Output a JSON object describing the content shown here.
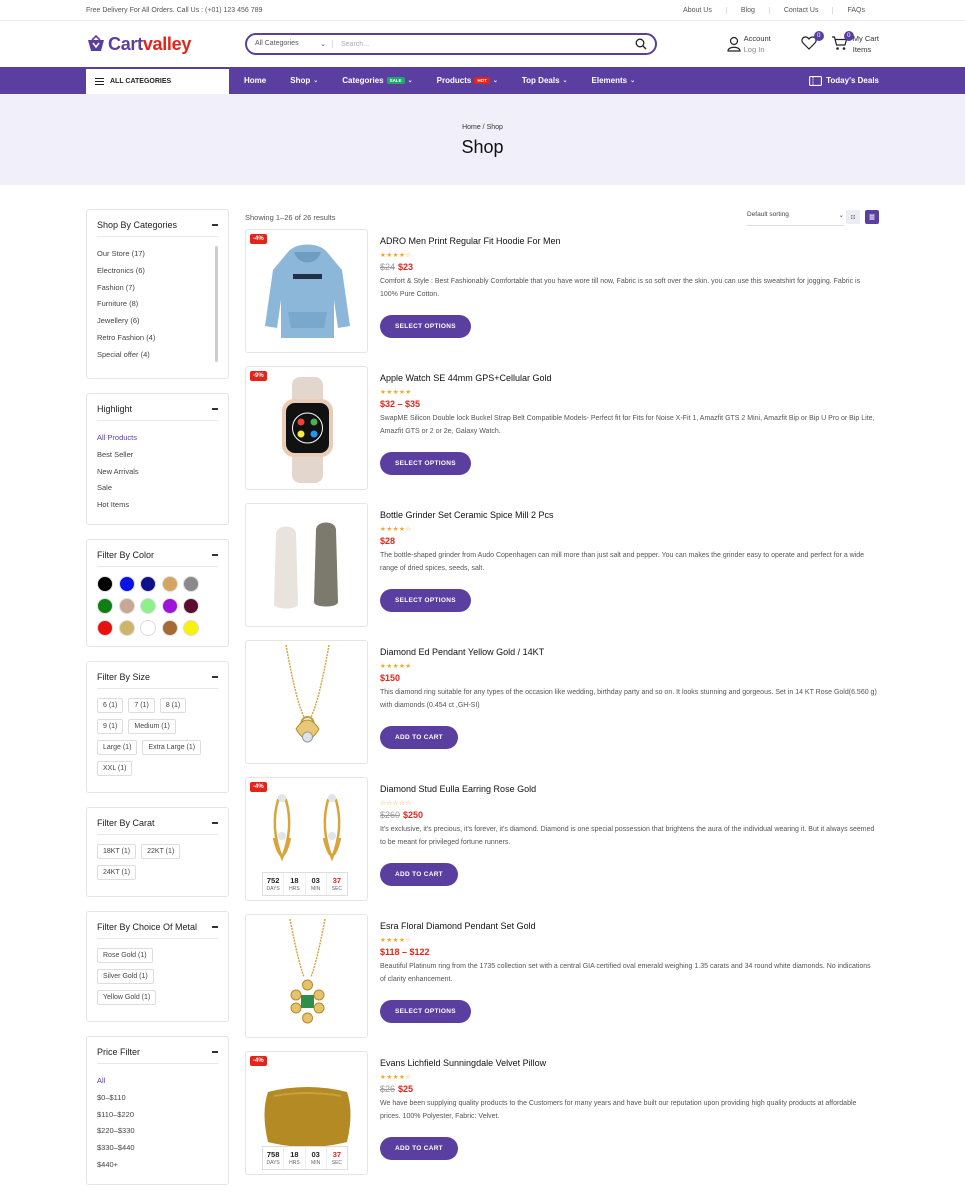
{
  "topbar": {
    "left": "Free Delivery For All Orders. Call Us : (+01) 123 456 789",
    "links": [
      "About Us",
      "Blog",
      "Contact Us",
      "FAQs"
    ]
  },
  "header": {
    "logo_part1": "Cart",
    "logo_part2": "valley",
    "search_category": "All Categories",
    "search_placeholder": "Search...",
    "account_label": "Account",
    "account_sub": "Log In",
    "wishlist_count": "0",
    "cart_count": "0",
    "cart_label": "My Cart",
    "cart_sub": "Items"
  },
  "nav": {
    "all_categories": "ALL CATEGORIES",
    "items": [
      {
        "label": "Home",
        "chev": "",
        "tag": ""
      },
      {
        "label": "Shop",
        "chev": "⌄",
        "tag": ""
      },
      {
        "label": "Categories",
        "chev": "⌄",
        "tag": "SALE"
      },
      {
        "label": "Products",
        "chev": "⌄",
        "tag": "HOT"
      },
      {
        "label": "Top Deals",
        "chev": "⌄",
        "tag": ""
      },
      {
        "label": "Elements",
        "chev": "⌄",
        "tag": ""
      }
    ],
    "deals": "Today's Deals",
    "sale_color": "#1fa86c",
    "hot_color": "#e2241b"
  },
  "banner": {
    "breadcrumb": "Home / Shop",
    "title": "Shop"
  },
  "sidebar": {
    "categories": {
      "title": "Shop By Categories",
      "items": [
        "Our Store (17)",
        "Electronics (6)",
        "Fashion (7)",
        "Furniture (8)",
        "Jewellery (6)",
        "Retro Fashion (4)",
        "Special offer (4)"
      ]
    },
    "highlight": {
      "title": "Highlight",
      "items": [
        "All Products",
        "Best Seller",
        "New Arrivals",
        "Sale",
        "Hot Items"
      ]
    },
    "color": {
      "title": "Filter By Color",
      "swatches": [
        "#000000",
        "#0a13e6",
        "#10108a",
        "#d6a461",
        "#8a8a8a",
        "#0f7f14",
        "#c8a893",
        "#8ef08a",
        "#9b16d9",
        "#5b0d2e",
        "#e8110f",
        "#cfb46b",
        "#ffffff",
        "#a66a35",
        "#f6f20a"
      ]
    },
    "size": {
      "title": "Filter By Size",
      "items": [
        "6 (1)",
        "7 (1)",
        "8 (1)",
        "9 (1)",
        "Medium (1)",
        "Large (1)",
        "Extra Large (1)",
        "XXL (1)"
      ]
    },
    "carat": {
      "title": "Filter By Carat",
      "items": [
        "18KT (1)",
        "22KT (1)",
        "24KT (1)"
      ]
    },
    "metal": {
      "title": "Filter By Choice Of Metal",
      "items": [
        "Rose Gold (1)",
        "Silver Gold (1)",
        "Yellow Gold (1)"
      ]
    },
    "price": {
      "title": "Price Filter",
      "items": [
        "All",
        "$0–$110",
        "$110–$220",
        "$220–$330",
        "$330–$440",
        "$440+"
      ]
    }
  },
  "toolbar": {
    "showing": "Showing 1–26 of 26 results",
    "sorting": "Default sorting"
  },
  "timer_labels": {
    "days": "DAYS",
    "hrs": "HRS",
    "min": "MIN",
    "sec": "SEC"
  },
  "products": [
    {
      "name": "ADRO Men Print Regular Fit Hoodie For Men",
      "discount": "-4%",
      "stars": "★★★★☆",
      "old_price": "$24",
      "price": "$23",
      "desc": "Comfort & Style : Best Fashionably Comfortable that you have wore till now, Fabric is so soft over the skin. you can use this sweatshirt for jogging. Fabric is 100% Pure Cotton.",
      "button": "SELECT OPTIONS",
      "image": "hoodie"
    },
    {
      "name": "Apple Watch SE 44mm GPS+Cellular Gold",
      "discount": "-9%",
      "stars": "★★★★★",
      "old_price": "",
      "price": "$32 – $35",
      "desc": "SwapME Silicon Double lock Buckel Strap Belt Compatible Models- Perfect fit for Fits for Noise X-Fit 1, Amazfit GTS 2 Mini, Amazfit Bip or Bip U Pro or Bip Lite, Amazfit GTS or 2 or 2e, Galaxy Watch.",
      "button": "SELECT OPTIONS",
      "image": "watch"
    },
    {
      "name": "Bottle Grinder Set Ceramic Spice Mill 2 Pcs",
      "discount": "",
      "stars": "★★★★☆",
      "old_price": "",
      "price": "$28",
      "desc": "The bottle-shaped grinder from Audo Copenhagen can mill more than just salt and pepper. You can makes the grinder easy to operate and perfect for a wide range of dried spices, seeds, salt.",
      "button": "SELECT OPTIONS",
      "image": "grinder"
    },
    {
      "name": "Diamond Ed Pendant Yellow Gold / 14KT",
      "discount": "",
      "stars": "★★★★★",
      "old_price": "",
      "price": "$150",
      "desc": "This diamond ring suitable for any types of the occasion like wedding, birthday party and so on. It looks stunning and gorgeous. Set in 14 KT Rose Gold(6.560 g) with diamonds (0.454 ct ,GH-SI)",
      "button": "ADD TO CART",
      "image": "pendant"
    },
    {
      "name": "Diamond Stud Eulla Earring Rose Gold",
      "discount": "-4%",
      "stars": "☆☆☆☆☆",
      "old_price": "$260",
      "price": "$250",
      "desc": "It's exclusive, it's precious, it's forever, it's diamond. Diamond is one special possession that brightens the aura of the individual wearing it. But it always seemed to be meant for privileged fortune runners.",
      "button": "ADD TO CART",
      "image": "earring",
      "timer": {
        "days": "752",
        "hrs": "18",
        "min": "03",
        "sec": "37"
      }
    },
    {
      "name": "Esra Floral Diamond Pendant Set Gold",
      "discount": "",
      "stars": "★★★★☆",
      "old_price": "",
      "price": "$118 – $122",
      "desc": "Beautiful Platinum ring from the 1735 collection set with a central GIA certified oval emerald weighing 1.35 carats and 34 round white diamonds. No indications of clarity enhancement.",
      "button": "SELECT OPTIONS",
      "image": "emerald"
    },
    {
      "name": "Evans Lichfield Sunningdale Velvet Pillow",
      "discount": "-4%",
      "stars": "★★★★☆",
      "old_price": "$26",
      "price": "$25",
      "desc": "We have been supplying quality products to the Customers for many years and have built our reputation upon providing high quality products at affordable prices. 100% Polyester, Fabric: Velvet.",
      "button": "ADD TO CART",
      "image": "pillow",
      "timer": {
        "days": "758",
        "hrs": "18",
        "min": "03",
        "sec": "37"
      }
    }
  ]
}
